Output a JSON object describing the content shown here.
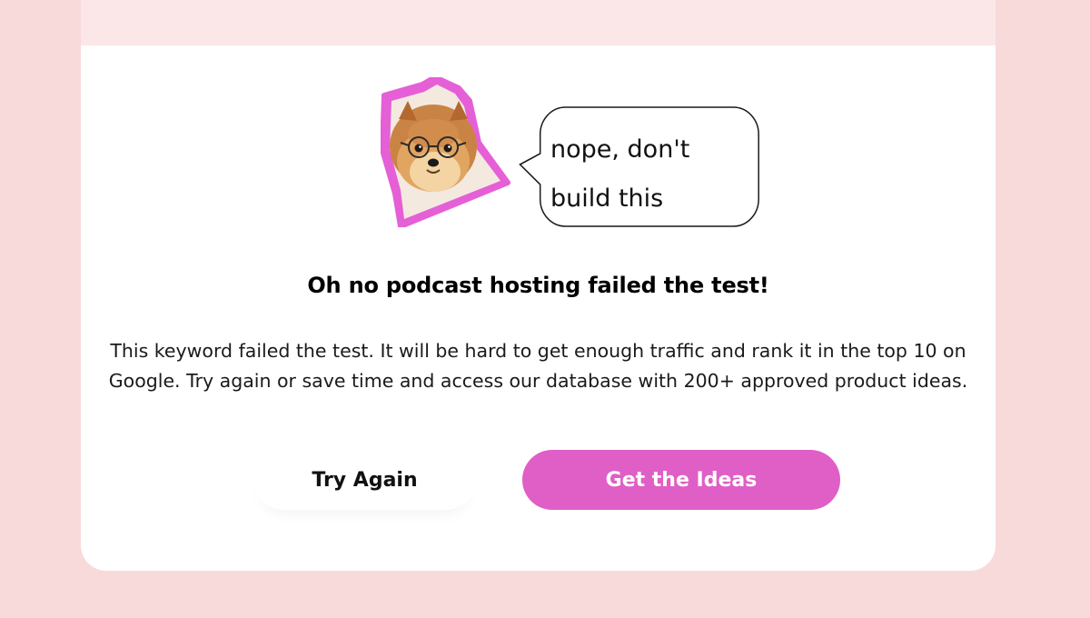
{
  "mascot": {
    "icon": "pomeranian-dog-with-glasses-icon",
    "outline_color": "#e55fd6"
  },
  "speech_bubble": {
    "line1": "nope, don't",
    "line2": "build this"
  },
  "result": {
    "headline": "Oh no podcast hosting failed the test!",
    "description": "This keyword failed the test. It will be hard to get enough traffic and rank it in the top 10 on Google. Try again or save time and access our database with 200+ approved product ideas."
  },
  "actions": {
    "try_again_label": "Try Again",
    "get_ideas_label": "Get the Ideas"
  },
  "colors": {
    "background": "#f8dadb",
    "card": "#ffffff",
    "accent": "#df5fc6"
  }
}
